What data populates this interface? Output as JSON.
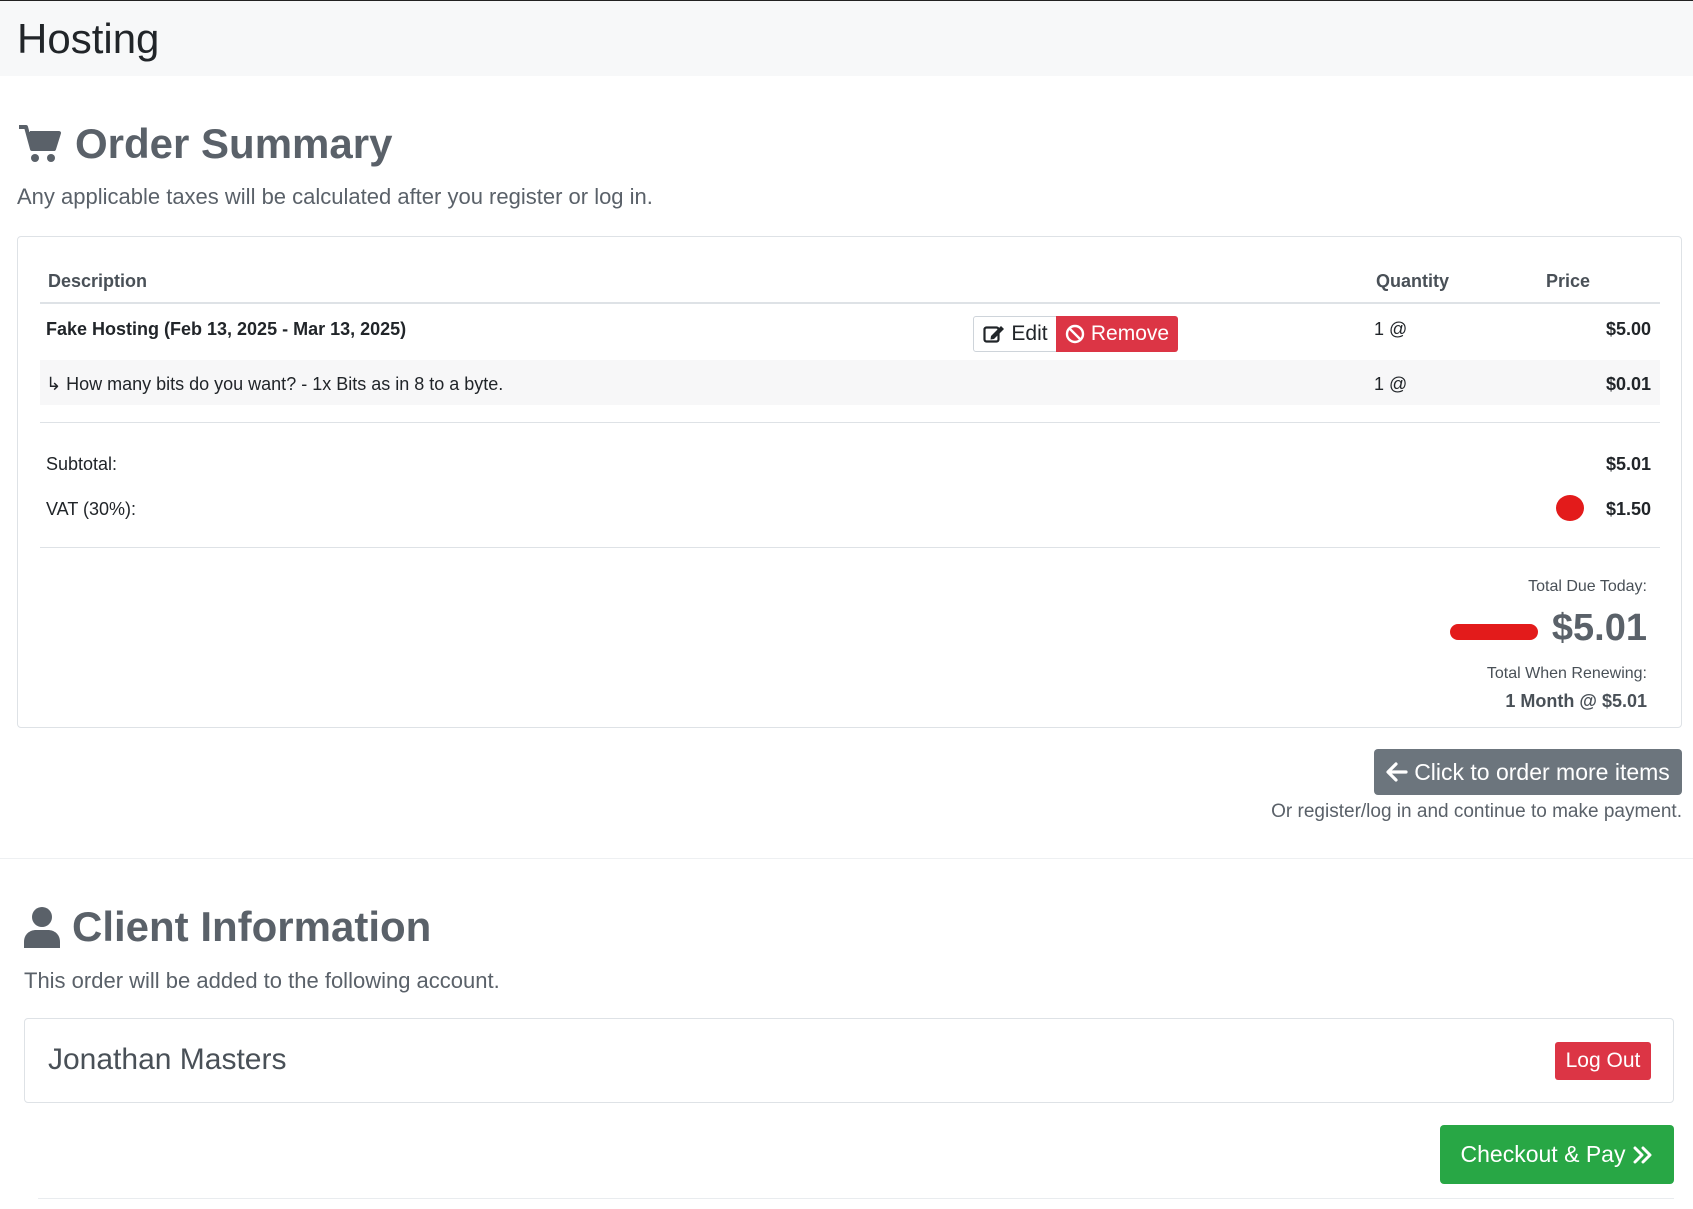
{
  "header": {
    "title": "Hosting"
  },
  "order_summary": {
    "title": "Order Summary",
    "note": "Any applicable taxes will be calculated after you register or log in.",
    "columns": {
      "description": "Description",
      "quantity": "Quantity",
      "price": "Price"
    },
    "items": [
      {
        "description": "Fake Hosting (Feb 13, 2025 - Mar 13, 2025)",
        "quantity": "1 @",
        "price": "$5.00"
      },
      {
        "description": "↳ How many bits do you want? - 1x Bits as in 8 to a byte.",
        "quantity": "1 @",
        "price": "$0.01"
      }
    ],
    "edit_label": "Edit",
    "remove_label": "Remove",
    "subtotal_label": "Subtotal:",
    "subtotal_value": "$5.01",
    "vat_label": "VAT (30%):",
    "vat_value": "$1.50",
    "total_due_label": "Total Due Today:",
    "total_due_value": "$5.01",
    "renewing_label": "Total When Renewing:",
    "renewing_value": "1 Month @ $5.01"
  },
  "actions": {
    "order_more_label": "Click to order more items",
    "order_more_note": "Or register/log in and continue to make payment."
  },
  "client_info": {
    "title": "Client Information",
    "note": "This order will be added to the following account.",
    "name": "Jonathan Masters",
    "logout_label": "Log Out"
  },
  "checkout": {
    "label": "Checkout & Pay"
  },
  "colors": {
    "danger": "#dc3545",
    "secondary": "#6c757d",
    "success": "#28a745",
    "annotation": "#e31b1b"
  },
  "icons": [
    "shopping-cart-icon",
    "edit-icon",
    "ban-icon",
    "arrow-left-icon",
    "user-icon",
    "double-chevron-right-icon"
  ]
}
